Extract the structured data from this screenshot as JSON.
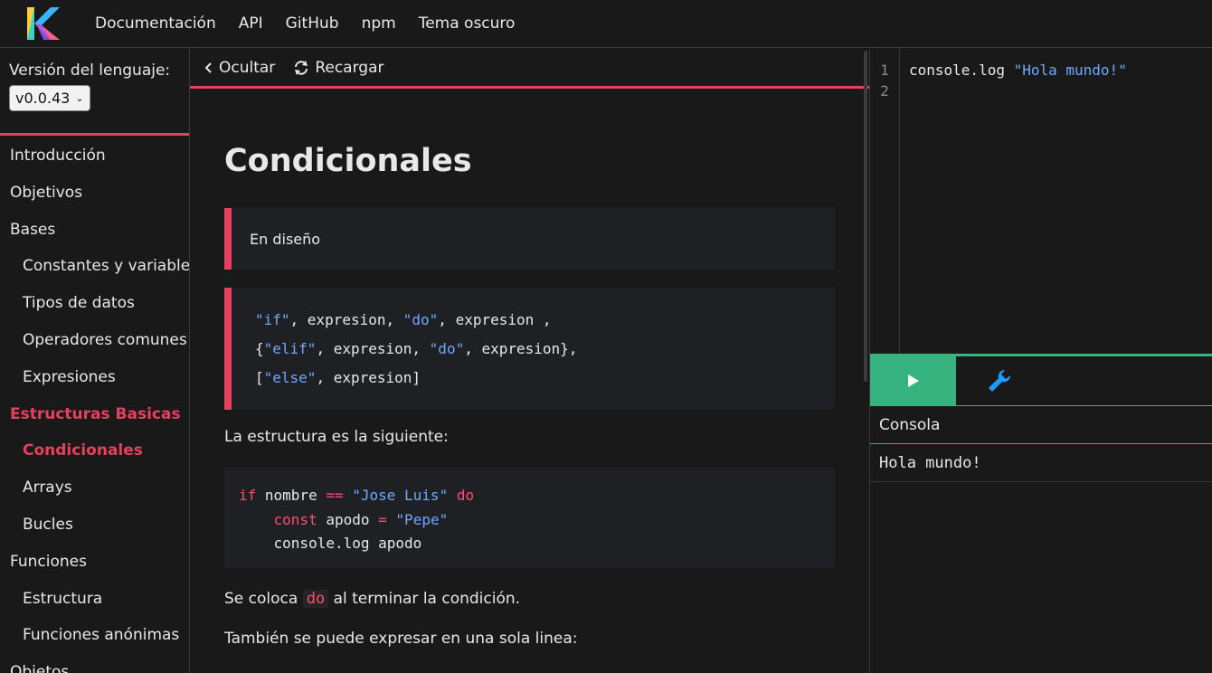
{
  "header": {
    "nav": [
      "Documentación",
      "API",
      "GitHub",
      "npm",
      "Tema oscuro"
    ]
  },
  "sidebar": {
    "version_label": "Versión del lenguaje:",
    "version_value": "v0.0.43",
    "items": [
      {
        "label": "Introducción",
        "level": 0
      },
      {
        "label": "Objetivos",
        "level": 0
      },
      {
        "label": "Bases",
        "level": 0
      },
      {
        "label": "Constantes y variables",
        "level": 1
      },
      {
        "label": "Tipos de datos",
        "level": 1
      },
      {
        "label": "Operadores comunes",
        "level": 1
      },
      {
        "label": "Expresiones",
        "level": 1
      },
      {
        "label": "Estructuras Basicas",
        "level": 0,
        "active": true
      },
      {
        "label": "Condicionales",
        "level": 1,
        "active": true
      },
      {
        "label": "Arrays",
        "level": 1
      },
      {
        "label": "Bucles",
        "level": 1
      },
      {
        "label": "Funciones",
        "level": 0
      },
      {
        "label": "Estructura",
        "level": 1
      },
      {
        "label": "Funciones anónimas",
        "level": 1
      },
      {
        "label": "Objetos",
        "level": 0
      }
    ]
  },
  "doc_toolbar": {
    "hide_label": "Ocultar",
    "reload_label": "Recargar"
  },
  "content": {
    "title": "Condicionales",
    "note": "En diseño",
    "syntax": {
      "l1_s1": "\"if\"",
      "l1_t1": ", expresion, ",
      "l1_s2": "\"do\"",
      "l1_t2": ", expresion ,",
      "l2_t0": "{",
      "l2_s1": "\"elif\"",
      "l2_t1": ", expresion, ",
      "l2_s2": "\"do\"",
      "l2_t2": ", expresion},",
      "l3_t0": "[",
      "l3_s1": "\"else\"",
      "l3_t1": ", expresion]"
    },
    "para1": "La estructura es la siguiente:",
    "example": {
      "k_if": "if",
      "t_nombre": " nombre ",
      "k_eq": "==",
      "s_jose": "\"Jose Luis\"",
      "k_do": "do",
      "k_const": "const",
      "t_apodo": " apodo ",
      "k_assign": "=",
      "s_pepe": "\"Pepe\"",
      "t_log": "console.log apodo"
    },
    "para2_before": "Se coloca ",
    "para2_code": "do",
    "para2_after": " al terminar la condición.",
    "para3": "También se puede expresar en una sola linea:"
  },
  "editor": {
    "line_numbers": [
      "1",
      "2"
    ],
    "code_text": "console.log ",
    "code_string": "\"Hola mundo!\"",
    "console_title": "Consola",
    "console_output": "Hola mundo!"
  },
  "colors": {
    "accent": "#e5405e",
    "run": "#36b37e",
    "string": "#6fa8ff",
    "keyword": "#ff4d6d",
    "wrench": "#1e9bff"
  }
}
